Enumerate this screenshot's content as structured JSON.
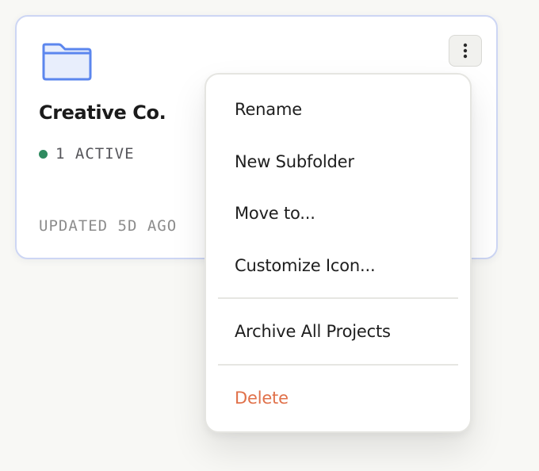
{
  "card": {
    "title": "Creative Co.",
    "status": "1 ACTIVE",
    "updated": "UPDATED 5D AGO",
    "icons": {
      "folder": "folder-icon",
      "more": "more-vertical-icon"
    },
    "colors": {
      "folder_stroke": "#5b86ee",
      "folder_fill": "#e8eefc",
      "status_dot": "#2e8a5f",
      "border": "#cdd6f4"
    }
  },
  "menu": {
    "items": [
      {
        "label": "Rename"
      },
      {
        "label": "New Subfolder"
      },
      {
        "label": "Move to..."
      },
      {
        "label": "Customize Icon..."
      },
      {
        "label": "Archive All Projects"
      },
      {
        "label": "Delete",
        "danger": true
      }
    ],
    "colors": {
      "danger": "#e0714a"
    }
  }
}
